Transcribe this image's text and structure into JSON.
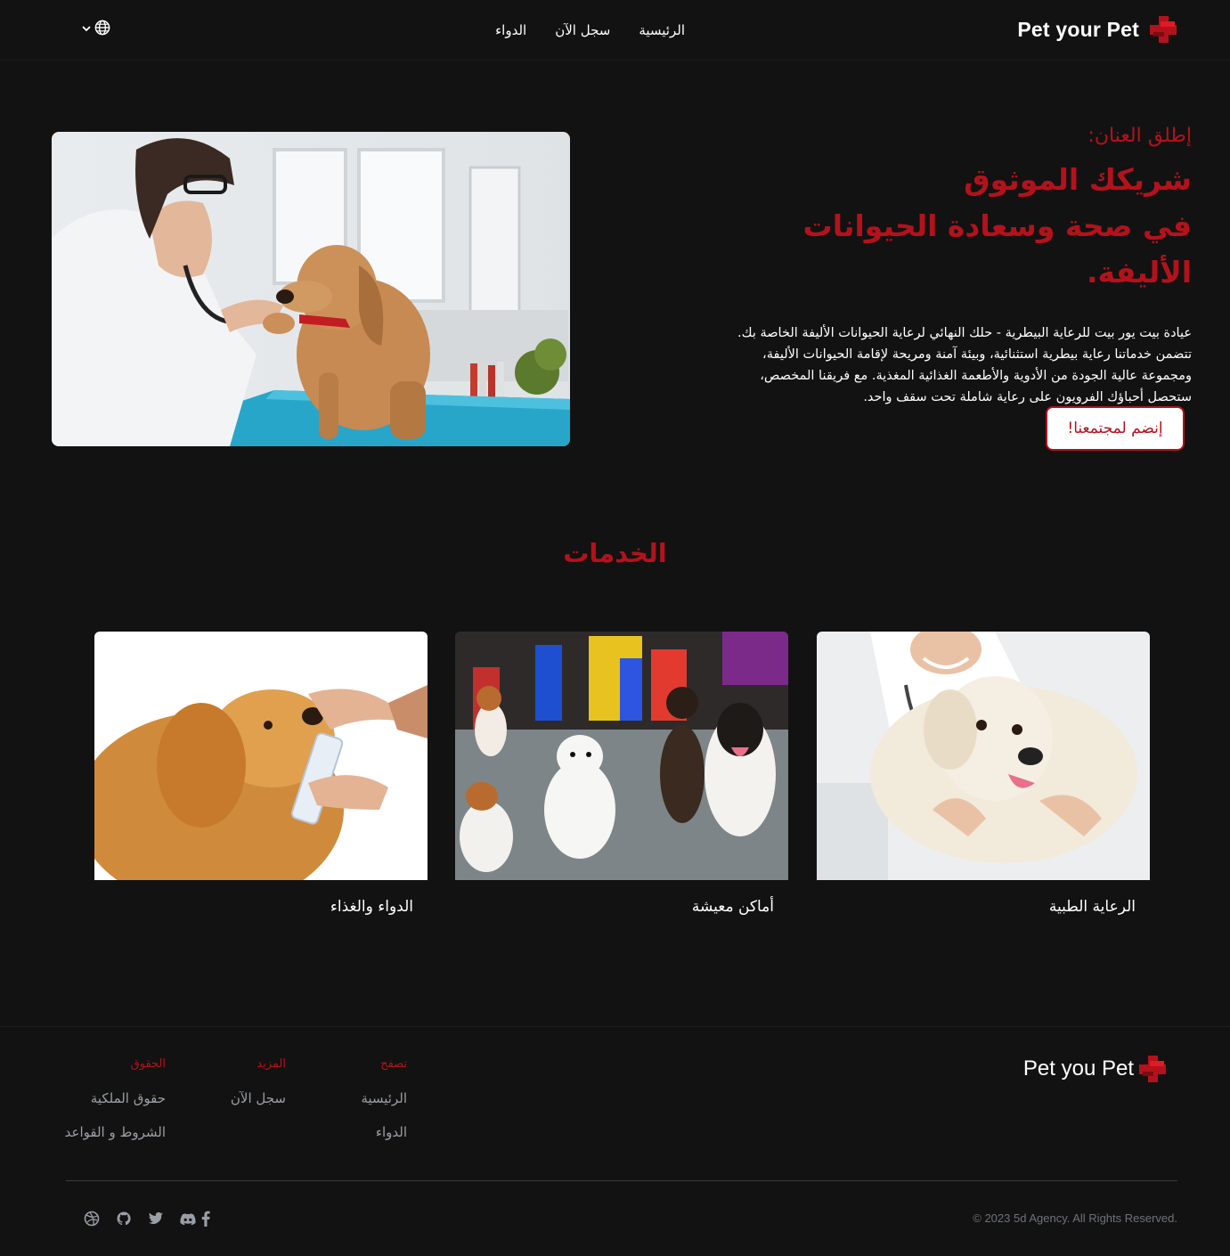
{
  "header": {
    "brand": "Pet your Pet",
    "nav": [
      "الرئيسية",
      "سجل الآن",
      "الدواء"
    ],
    "language_icon": "globe-icon"
  },
  "hero": {
    "eyebrow": "إطلق العنان:",
    "title_line1": "شريكك الموثوق",
    "title_line2": "في صحة وسعادة الحيوانات الأليفة.",
    "description_lines": [
      "عيادة بيت يور بيت للرعاية البيطرية - حلك النهائي لرعاية الحيوانات الأليفة الخاصة بك.",
      "تتضمن خدماتنا رعاية بيطرية استثنائية، وبيئة آمنة ومريحة لإقامة الحيوانات الأليفة،",
      "ومجموعة عالية الجودة من الأدوية والأطعمة الغذائية المغذية. مع فريقنا المخصص،",
      "ستحصل أحباؤك الفرويون على رعاية شاملة تحت سقف واحد."
    ],
    "cta": "إنضم لمجتمعنا!"
  },
  "services": {
    "title": "الخدمات",
    "items": [
      "الرعاية الطبية",
      "أماكن معيشة",
      "الدواء والغذاء"
    ]
  },
  "footer": {
    "brand": "Pet you Pet",
    "columns": [
      {
        "heading": "تصفح",
        "links": [
          "الرئيسية",
          "الدواء"
        ]
      },
      {
        "heading": "المزيد",
        "links": [
          "سجل الآن"
        ]
      },
      {
        "heading": "الحقوق",
        "links": [
          "حقوق الملكية",
          "الشروط و القواعد"
        ]
      }
    ],
    "copyright": "© 2023 5d Agency. All Rights Reserved.",
    "social_icons": [
      "facebook-icon",
      "discord-icon",
      "twitter-icon",
      "github-icon",
      "dribbble-icon"
    ]
  },
  "colors": {
    "accent": "#b3121c",
    "background": "#121212",
    "muted": "#9a9ea6"
  }
}
